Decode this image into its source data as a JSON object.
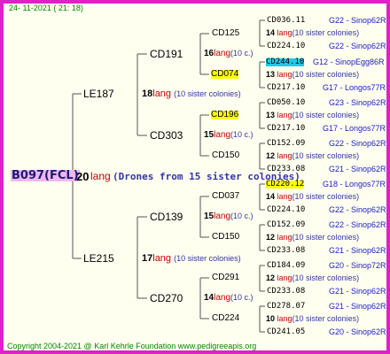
{
  "header": {
    "date": "24- 11-2021 ( 21: 18)"
  },
  "footer": {
    "copyright": "Copyright 2004-2021 @ Karl Kehrle Foundation   www.pedigreeapis.org"
  },
  "root": {
    "id": "B097(FCL)",
    "num": "20",
    "lang": "lang",
    "note": "(Drones from 15 sister colonies)"
  },
  "colors": {
    "frame": "#e020c8",
    "highlight_yellow": "#ffff00",
    "highlight_cyan": "#22c8e8",
    "red": "#cc0000",
    "blue": "#1a1acc"
  },
  "level1": [
    {
      "name": "LE187",
      "num": "18",
      "lang": "lang",
      "sis": "(10 sister colonies)"
    },
    {
      "name": "LE215",
      "num": "17",
      "lang": "lang",
      "sis": "(10 sister colonies)"
    }
  ],
  "level2": [
    {
      "name": "CD191",
      "num": "16",
      "lang": "lang",
      "sis": "(10 c.)"
    },
    {
      "name": "CD303",
      "num": "15",
      "lang": "lang",
      "sis": "(10 c.)"
    },
    {
      "name": "CD139",
      "num": "15",
      "lang": "lang",
      "sis": "(10 c.)"
    },
    {
      "name": "CD270",
      "num": "14",
      "lang": "lang",
      "sis": "(10 c.)"
    }
  ],
  "level3": [
    {
      "name": "CD125",
      "num": "14",
      "lang": "lang",
      "sis": "(10 sister colonies)"
    },
    {
      "name": "CD074",
      "num": "13",
      "lang": "lang",
      "sis": "(10 sister colonies)"
    },
    {
      "name": "CD196",
      "num": "13",
      "lang": "lang",
      "sis": "(10 sister colonies)"
    },
    {
      "name": "CD150",
      "num": "12",
      "lang": "lang",
      "sis": "(10 sister colonies)"
    },
    {
      "name": "CD037",
      "num": "14",
      "lang": "lang",
      "sis": "(10 sister colonies)"
    },
    {
      "name": "CD150",
      "num": "12",
      "lang": "lang",
      "sis": "(10 sister colonies)"
    },
    {
      "name": "CD291",
      "num": "12",
      "lang": "lang",
      "sis": "(10 sister colonies)"
    },
    {
      "name": "CD224",
      "num": "10",
      "lang": "lang",
      "sis": "(10 sister colonies)"
    }
  ],
  "level4": [
    {
      "name": "CD036.11",
      "info": "G22 - Sinop62R"
    },
    {
      "name": "CD224.10",
      "info": "G22 - Sinop62R"
    },
    {
      "name": "CD244.10",
      "info": "G12 - SinopEgg86R"
    },
    {
      "name": "CD217.10",
      "info": "G17 - Longos77R"
    },
    {
      "name": "CD050.10",
      "info": "G23 - Sinop62R"
    },
    {
      "name": "CD217.10",
      "info": "G17 - Longos77R"
    },
    {
      "name": "CD152.09",
      "info": "G22 - Sinop62R"
    },
    {
      "name": "CD233.08",
      "info": "G21 - Sinop62R"
    },
    {
      "name": "CD220.12",
      "info": "G18 - Longos77R"
    },
    {
      "name": "CD224.10",
      "info": "G22 - Sinop62R"
    },
    {
      "name": "CD152.09",
      "info": "G22 - Sinop62R"
    },
    {
      "name": "CD233.08",
      "info": "G21 - Sinop62R"
    },
    {
      "name": "CD184.09",
      "info": "G20 - Sinop72R"
    },
    {
      "name": "CD233.08",
      "info": "G21 - Sinop62R"
    },
    {
      "name": "CD278.07",
      "info": "G21 - Sinop62R"
    },
    {
      "name": "CD241.05",
      "info": "G20 - Sinop62R"
    }
  ]
}
